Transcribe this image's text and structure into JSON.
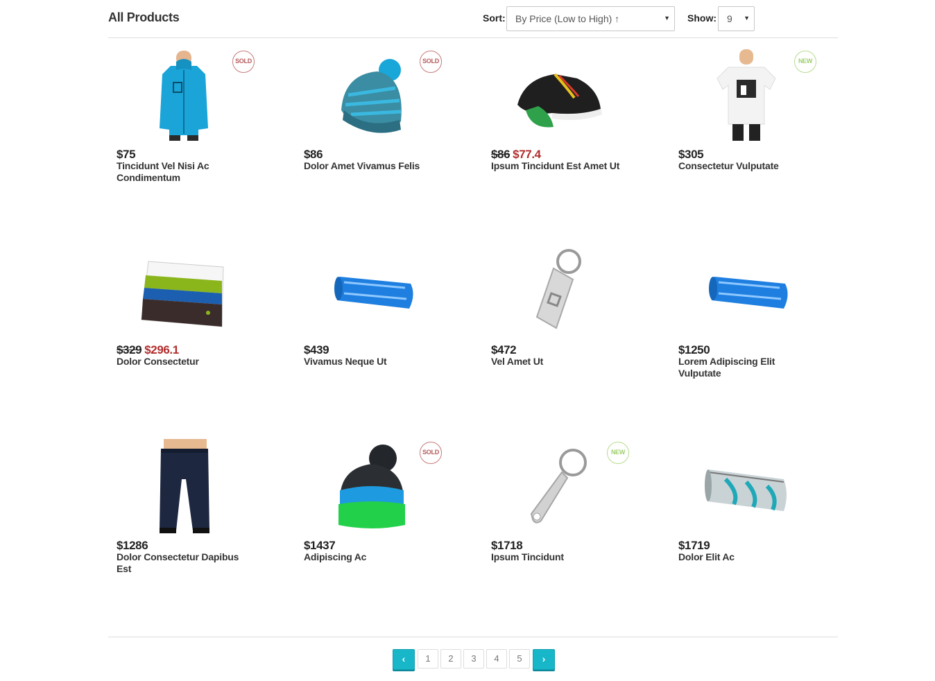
{
  "header": {
    "title": "All Products",
    "sort_label": "Sort:",
    "sort_value": "By Price (Low to High) ↑",
    "show_label": "Show:",
    "show_value": "9"
  },
  "products": [
    {
      "price": "$75",
      "sale_price": "",
      "name": "Tincidunt Vel Nisi Ac Condimentum",
      "badge": "SOLD",
      "image": "hoodie-image"
    },
    {
      "price": "$86",
      "sale_price": "",
      "name": "Dolor Amet Vivamus Felis",
      "badge": "SOLD",
      "image": "beanie-image"
    },
    {
      "price": "$86",
      "sale_price": "$77.4",
      "name": "Ipsum Tincidunt Est Amet Ut",
      "badge": "",
      "image": "sneaker-image"
    },
    {
      "price": "$305",
      "sale_price": "",
      "name": "Consectetur Vulputate",
      "badge": "NEW",
      "image": "tshirt-image"
    },
    {
      "price": "$329",
      "sale_price": "$296.1",
      "name": "Dolor Consectetur",
      "badge": "",
      "image": "wallet-image"
    },
    {
      "price": "$439",
      "sale_price": "",
      "name": "Vivamus Neque Ut",
      "badge": "",
      "image": "pencil-case-image"
    },
    {
      "price": "$472",
      "sale_price": "",
      "name": "Vel Amet Ut",
      "badge": "",
      "image": "keychain-image"
    },
    {
      "price": "$1250",
      "sale_price": "",
      "name": "Lorem Adipiscing Elit Vulputate",
      "badge": "",
      "image": "pencil-case-image"
    },
    {
      "price": "$1286",
      "sale_price": "",
      "name": "Dolor Consectetur Dapibus Est",
      "badge": "",
      "image": "jeans-image"
    },
    {
      "price": "$1437",
      "sale_price": "",
      "name": "Adipiscing Ac",
      "badge": "SOLD",
      "image": "pompom-beanie-image"
    },
    {
      "price": "$1718",
      "sale_price": "",
      "name": "Ipsum Tincidunt",
      "badge": "NEW",
      "image": "bottle-opener-image"
    },
    {
      "price": "$1719",
      "sale_price": "",
      "name": "Dolor Elit Ac",
      "badge": "",
      "image": "round-pencil-case-image"
    }
  ],
  "pagination": {
    "prev_icon": "chevron-left-icon",
    "pages": [
      "1",
      "2",
      "3",
      "4",
      "5"
    ],
    "next_icon": "chevron-right-icon"
  },
  "colors": {
    "accent": "#17b6c8",
    "sale_price": "#b32d2d",
    "sold_badge": "#c77a7a",
    "new_badge": "#b7dc8f"
  }
}
